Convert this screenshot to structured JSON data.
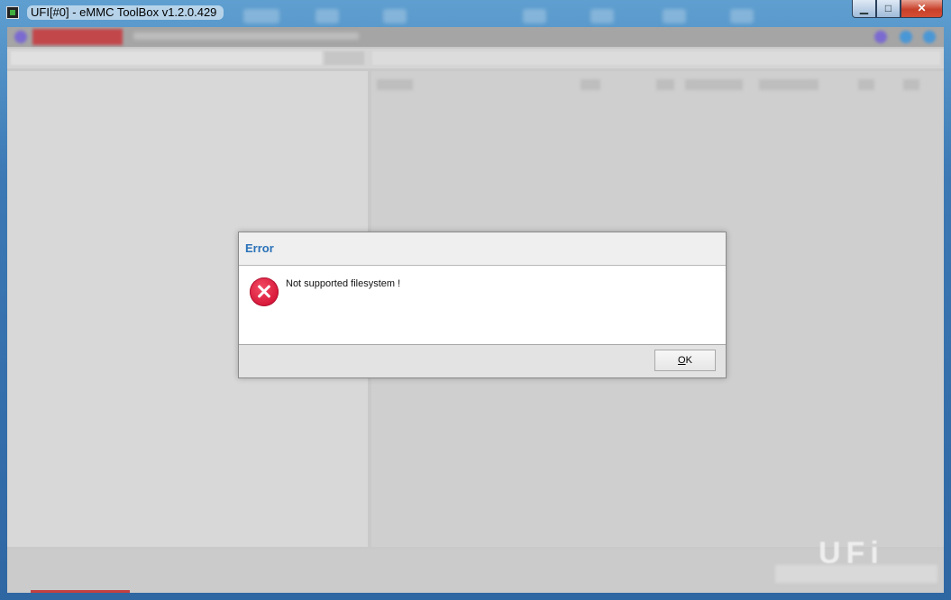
{
  "window": {
    "title": "UFI[#0] - eMMC ToolBox v1.2.0.429",
    "minimize_glyph": "▁",
    "maximize_glyph": "□",
    "close_glyph": "✕"
  },
  "app": {
    "logo_text": "UFi"
  },
  "dialog": {
    "title": "Error",
    "message": "Not supported filesystem !",
    "icon": "error-icon",
    "ok_label_mnemonic": "O",
    "ok_label_rest": "K"
  },
  "colors": {
    "dialog_title": "#2a72b8",
    "error_icon": "#d8183a",
    "accent_tab": "#c2474b"
  }
}
